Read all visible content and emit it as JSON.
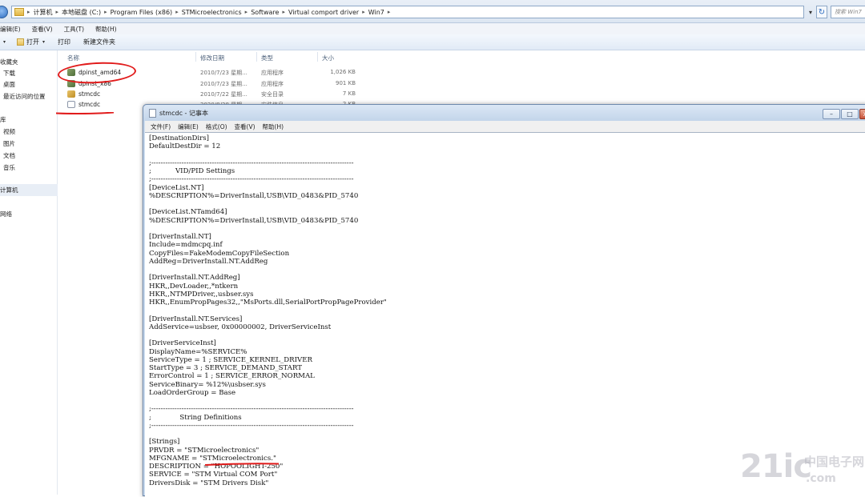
{
  "explorer": {
    "breadcrumbs": [
      "计算机",
      "本地磁盘 (C:)",
      "Program Files (x86)",
      "STMicroelectronics",
      "Software",
      "Virtual comport driver",
      "Win7"
    ],
    "search_placeholder": "搜索 Win7",
    "menu": [
      "编辑(E)",
      "查看(V)",
      "工具(T)",
      "帮助(H)"
    ],
    "toolbar": {
      "open_label": "打开",
      "print_label": "打印",
      "new_folder_label": "新建文件夹"
    },
    "sidebar": {
      "favorites": "收藏夹",
      "downloads": "下载",
      "desktop": "桌面",
      "recent": "最近访问的位置",
      "libraries": "库",
      "videos": "视频",
      "pictures": "图片",
      "documents": "文档",
      "music": "音乐",
      "computer": "计算机",
      "network": "网络"
    },
    "columns": {
      "name": "名称",
      "date": "修改日期",
      "type": "类型",
      "size": "大小"
    },
    "files": [
      {
        "name": "dpinst_amd64",
        "date": "2010/7/23 星期...",
        "type": "应用程序",
        "size": "1,026 KB",
        "icon": "exe-icon"
      },
      {
        "name": "dpinst_x86",
        "date": "2010/7/23 星期...",
        "type": "应用程序",
        "size": "901 KB",
        "icon": "exe-icon"
      },
      {
        "name": "stmcdc",
        "date": "2010/7/22 星期...",
        "type": "安全目录",
        "size": "7 KB",
        "icon": "catalog-icon"
      },
      {
        "name": "stmcdc",
        "date": "2020/8/28 星期...",
        "type": "安装信息",
        "size": "2 KB",
        "icon": "inf-icon"
      }
    ]
  },
  "notepad": {
    "title": "stmcdc - 记事本",
    "menu": [
      "文件(F)",
      "编辑(E)",
      "格式(O)",
      "查看(V)",
      "帮助(H)"
    ],
    "minimize": "–",
    "maximize": "□",
    "close": "x",
    "content": "[DestinationDirs]\nDefaultDestDir = 12\n\n;---------------------------------------------------------------------------------------\n;           VID/PID Settings\n;---------------------------------------------------------------------------------------\n[DeviceList.NT]\n%DESCRIPTION%=DriverInstall,USB\\VID_0483&PID_5740\n\n[DeviceList.NTamd64]\n%DESCRIPTION%=DriverInstall,USB\\VID_0483&PID_5740\n\n[DriverInstall.NT]\nInclude=mdmcpq.inf\nCopyFiles=FakeModemCopyFileSection\nAddReg=DriverInstall.NT.AddReg\n\n[DriverInstall.NT.AddReg]\nHKR,,DevLoader,,*ntkern\nHKR,,NTMPDriver,,usbser.sys\nHKR,,EnumPropPages32,,\"MsPorts.dll,SerialPortPropPageProvider\"\n\n[DriverInstall.NT.Services]\nAddService=usbser, 0x00000002, DriverServiceInst\n\n[DriverServiceInst]\nDisplayName=%SERVICE%\nServiceType = 1 ; SERVICE_KERNEL_DRIVER\nStartType = 3 ; SERVICE_DEMAND_START\nErrorControl = 1 ; SERVICE_ERROR_NORMAL\nServiceBinary= %12%\\usbser.sys\nLoadOrderGroup = Base\n\n;---------------------------------------------------------------------------------------\n;             String Definitions\n;---------------------------------------------------------------------------------------\n\n[Strings]\nPRVDR = \"STMicroelectronics\"\nMFGNAME = \"STMicroelectronics.\"\nDESCRIPTION = \"HOPOOLIGHT-250\"\nSERVICE = \"STM Virtual COM Port\"\nDriversDisk = \"STM Drivers Disk\""
  },
  "watermark": {
    "logo": "21ic",
    "cn": "中国电子网",
    "com": ".com"
  },
  "colors": {
    "annotation": "#e11b1b",
    "titlebar": "#c3d5ea"
  }
}
